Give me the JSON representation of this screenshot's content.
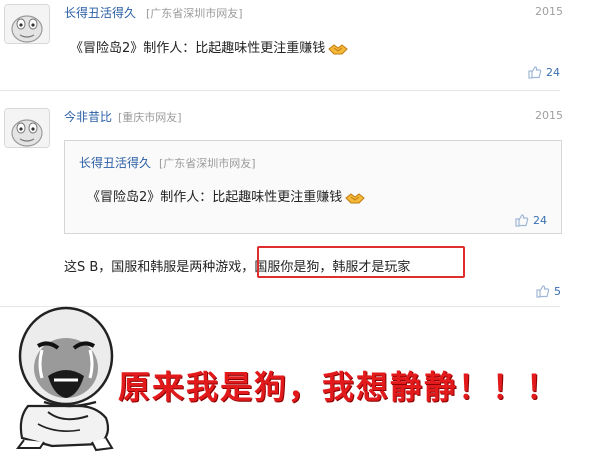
{
  "comments": [
    {
      "username": "长得丑活得久",
      "location": "[广东省深圳市网友]",
      "date": "2015",
      "text": "《冒险岛2》制作人：比起趣味性更注重赚钱",
      "likes": "24"
    },
    {
      "username": "今非昔比",
      "location": "[重庆市网友]",
      "date": "2015",
      "quote": {
        "username": "长得丑活得久",
        "location": "[广东省深圳市网友]",
        "text": "《冒险岛2》制作人：比起趣味性更注重赚钱",
        "likes": "24"
      },
      "text_part1": "这S B，国服和韩服是两种游戏，",
      "text_highlight": "国服你是狗，韩服才是玩家",
      "likes": "5"
    }
  ],
  "caption": "原来我是狗，我想静静！！！",
  "icons": {
    "like": "thumbs-up-icon",
    "handshake": "handshake-emoji-icon",
    "avatar": "default-avatar-icon"
  },
  "colors": {
    "username": "#2a5ea6",
    "highlight_box": "#e02d2d",
    "caption": "#e31a1c"
  }
}
